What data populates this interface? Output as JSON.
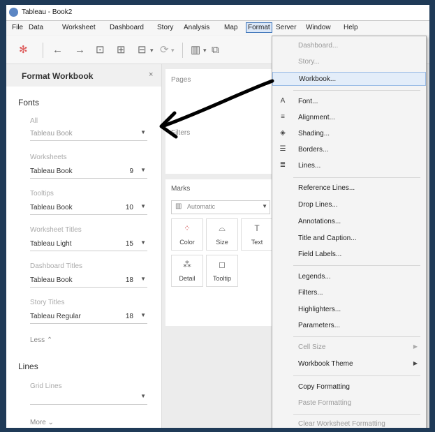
{
  "window": {
    "title": "Tableau - Book2"
  },
  "menubar": [
    "File",
    "Data",
    "Worksheet",
    "Dashboard",
    "Story",
    "Analysis",
    "Map",
    "Format",
    "Server",
    "Window",
    "Help"
  ],
  "format_panel": {
    "title": "Format Workbook",
    "close": "×",
    "fonts_heading": "Fonts",
    "rows": [
      {
        "label": "All",
        "font": "Tableau Book",
        "size": ""
      },
      {
        "label": "Worksheets",
        "font": "Tableau Book",
        "size": "9"
      },
      {
        "label": "Tooltips",
        "font": "Tableau Book",
        "size": "10"
      },
      {
        "label": "Worksheet Titles",
        "font": "Tableau Light",
        "size": "15"
      },
      {
        "label": "Dashboard Titles",
        "font": "Tableau Book",
        "size": "18"
      },
      {
        "label": "Story Titles",
        "font": "Tableau Regular",
        "size": "18"
      }
    ],
    "less_link": "Less ⌃",
    "lines_heading": "Lines",
    "grid_lines_label": "Grid Lines",
    "more_link": "More ⌄"
  },
  "canvas": {
    "pages": "Pages",
    "filters": "Filters",
    "marks": "Marks",
    "marks_type": "Automatic",
    "cards": [
      "Color",
      "Size",
      "Text",
      "Detail",
      "Tooltip"
    ]
  },
  "format_menu": {
    "items": [
      {
        "label": "Dashboard...",
        "disabled": true,
        "icon": ""
      },
      {
        "label": "Story...",
        "disabled": true,
        "icon": ""
      },
      {
        "label": "Workbook...",
        "disabled": false,
        "icon": "",
        "highlight": true
      },
      {
        "label": "Font...",
        "disabled": false,
        "icon": "A"
      },
      {
        "label": "Alignment...",
        "disabled": false,
        "icon": "≡"
      },
      {
        "label": "Shading...",
        "disabled": false,
        "icon": "◈"
      },
      {
        "label": "Borders...",
        "disabled": false,
        "icon": "☰"
      },
      {
        "label": "Lines...",
        "disabled": false,
        "icon": "≣"
      },
      {
        "label": "Reference Lines...",
        "disabled": false,
        "icon": ""
      },
      {
        "label": "Drop Lines...",
        "disabled": false,
        "icon": ""
      },
      {
        "label": "Annotations...",
        "disabled": false,
        "icon": ""
      },
      {
        "label": "Title and Caption...",
        "disabled": false,
        "icon": ""
      },
      {
        "label": "Field Labels...",
        "disabled": false,
        "icon": ""
      },
      {
        "label": "Legends...",
        "disabled": false,
        "icon": ""
      },
      {
        "label": "Filters...",
        "disabled": false,
        "icon": ""
      },
      {
        "label": "Highlighters...",
        "disabled": false,
        "icon": ""
      },
      {
        "label": "Parameters...",
        "disabled": false,
        "icon": ""
      },
      {
        "label": "Cell Size",
        "disabled": true,
        "icon": "",
        "submenu": true
      },
      {
        "label": "Workbook Theme",
        "disabled": false,
        "icon": "",
        "submenu": true
      },
      {
        "label": "Copy Formatting",
        "disabled": false,
        "icon": ""
      },
      {
        "label": "Paste Formatting",
        "disabled": true,
        "icon": ""
      },
      {
        "label": "Clear Worksheet Formatting",
        "disabled": true,
        "icon": ""
      }
    ]
  }
}
